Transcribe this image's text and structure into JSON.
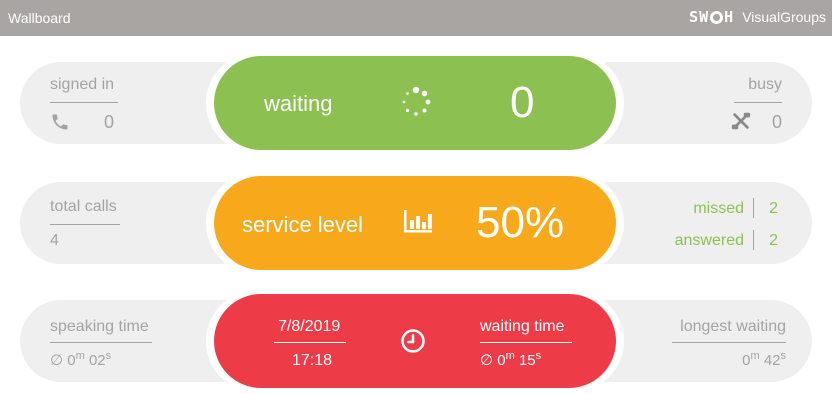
{
  "header": {
    "title": "Wallboard",
    "brand_letters": [
      "S",
      "W",
      "H"
    ],
    "brand_name": "VisualGroups"
  },
  "row1": {
    "left": {
      "label": "signed in",
      "icon": "phone-icon",
      "value": "0"
    },
    "center": {
      "label": "waiting",
      "icon": "spinner-icon",
      "value": "0"
    },
    "right": {
      "label": "busy",
      "icon": "phone-busy-icon",
      "value": "0"
    }
  },
  "row2": {
    "left": {
      "label": "total calls",
      "value": "4"
    },
    "center": {
      "label": "service level",
      "icon": "bar-chart-icon",
      "value": "50%"
    },
    "right": {
      "missed_label": "missed",
      "missed_value": "2",
      "answered_label": "answered",
      "answered_value": "2"
    }
  },
  "row3": {
    "left": {
      "label": "speaking time",
      "avg_symbol": "∅",
      "value_pre": "0",
      "m": "m",
      "value_mid": "02",
      "s": "s"
    },
    "center": {
      "date": "7/8/2019",
      "time": "17:18",
      "icon": "clock-icon",
      "waiting_label": "waiting time",
      "avg_symbol": "∅",
      "value_pre": "0",
      "m": "m",
      "value_mid": "15",
      "s": "s"
    },
    "right": {
      "label": "longest waiting",
      "value_pre": "0",
      "m": "m",
      "value_mid": "42",
      "s": "s"
    }
  },
  "colors": {
    "green": "#8cc152",
    "orange": "#f7a81b",
    "red": "#ee3b48",
    "header": "#a8a5a3",
    "muted": "#a3a3a3"
  }
}
